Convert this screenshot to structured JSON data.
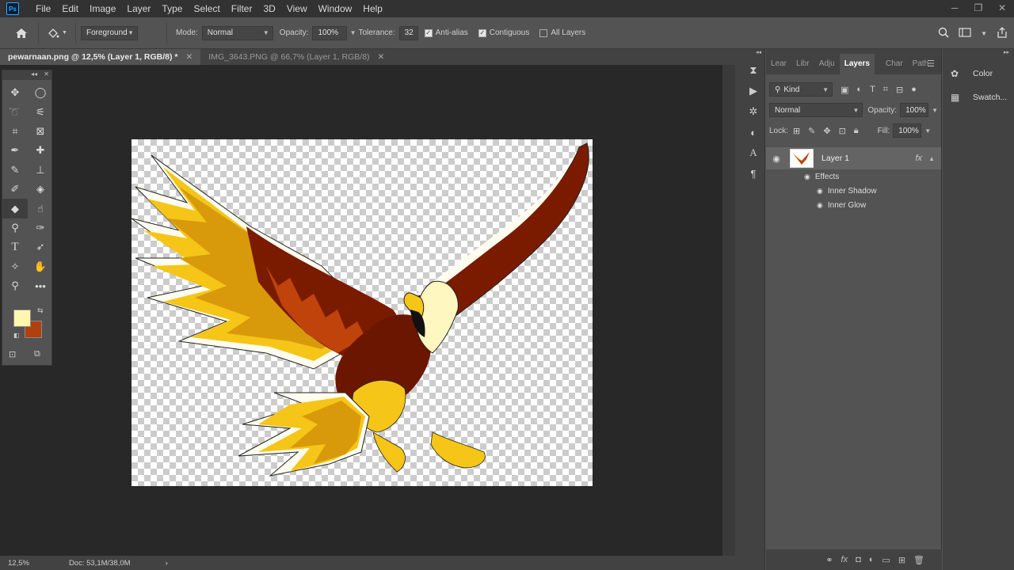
{
  "app": {
    "logo": "Ps"
  },
  "menu": [
    "File",
    "Edit",
    "Image",
    "Layer",
    "Type",
    "Select",
    "Filter",
    "3D",
    "View",
    "Window",
    "Help"
  ],
  "window_controls": {
    "minimize": "─",
    "restore": "❐",
    "close": "✕"
  },
  "options_bar": {
    "fill_source": "Foreground",
    "mode_label": "Mode:",
    "mode_value": "Normal",
    "opacity_label": "Opacity:",
    "opacity_value": "100%",
    "tolerance_label": "Tolerance:",
    "tolerance_value": "32",
    "antialias_label": "Anti-alias",
    "contiguous_label": "Contiguous",
    "all_layers_label": "All Layers"
  },
  "tabs": [
    {
      "label": "pewarnaan.png @ 12,5% (Layer 1, RGB/8) *",
      "active": true
    },
    {
      "label": "IMG_3643.PNG @ 66,7% (Layer 1, RGB/8)",
      "active": false
    }
  ],
  "tools": [
    "move-tool",
    "marquee-tool",
    "lasso-tool",
    "quick-select-tool",
    "crop-tool",
    "frame-tool",
    "eyedropper-tool",
    "healing-tool",
    "brush-tool",
    "stamp-tool",
    "history-brush-tool",
    "eraser-tool",
    "paint-bucket-tool",
    "smudge-tool",
    "dodge-tool",
    "pen-tool",
    "type-tool",
    "path-select-tool",
    "shape-tool",
    "hand-tool",
    "zoom-tool",
    "more-tools"
  ],
  "colors": {
    "foreground": "#fff7b0",
    "background": "#b0410e",
    "accent": "#31a8ff"
  },
  "status": {
    "zoom": "12,5%",
    "doc": "Doc: 53,1M/38,0M"
  },
  "layers_panel": {
    "tabs": [
      "Lear",
      "Libr",
      "Adju",
      "Layers",
      "Char",
      "Path"
    ],
    "kind_label": "Kind",
    "blend_mode": "Normal",
    "opacity_label": "Opacity:",
    "opacity_value": "100%",
    "lock_label": "Lock:",
    "fill_label": "Fill:",
    "fill_value": "100%",
    "layer_name": "Layer 1",
    "fx_label": "fx",
    "effects_label": "Effects",
    "effects": [
      "Inner Shadow",
      "Inner Glow"
    ]
  },
  "side_panel": {
    "color_label": "Color",
    "swatches_label": "Swatch..."
  }
}
